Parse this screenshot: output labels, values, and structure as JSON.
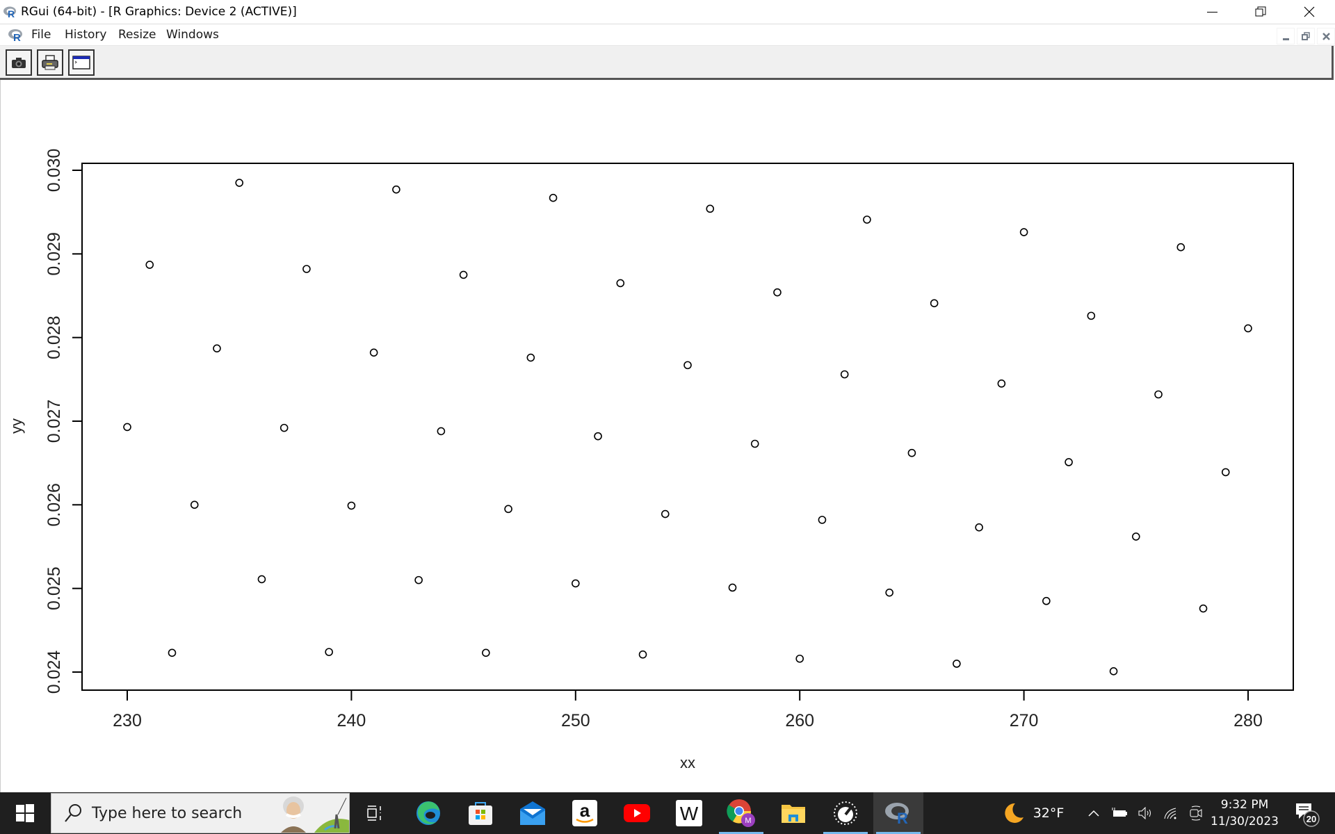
{
  "window": {
    "title": "RGui (64-bit) - [R Graphics: Device 2 (ACTIVE)]",
    "controls": {
      "minimize": "—",
      "restore": "❐",
      "close": "✕"
    }
  },
  "menubar": {
    "items": [
      {
        "label": "File"
      },
      {
        "label": "History"
      },
      {
        "label": "Resize"
      },
      {
        "label": "Windows"
      }
    ],
    "mdi_controls": {
      "minimize": "▁",
      "restore": "🗗",
      "close": "✕"
    }
  },
  "toolbar": {
    "buttons": [
      {
        "icon": "camera-icon",
        "tooltip": "Copy to clipboard"
      },
      {
        "icon": "printer-icon",
        "tooltip": "Print"
      },
      {
        "icon": "console-icon",
        "tooltip": "Return focus to console"
      }
    ]
  },
  "chart_data": {
    "type": "scatter",
    "title": "",
    "xlabel": "xx",
    "ylabel": "yy",
    "xlim": [
      228,
      282
    ],
    "ylim": [
      0.0238,
      0.0302
    ],
    "grid": false,
    "legend": "none",
    "marker": "open-circle",
    "xticks": [
      230,
      240,
      250,
      260,
      270,
      280
    ],
    "xtick_labels": [
      "230",
      "240",
      "250",
      "260",
      "270",
      "280"
    ],
    "yticks": [
      0.024,
      0.025,
      0.026,
      0.027,
      0.028,
      0.029,
      0.03
    ],
    "ytick_labels": [
      "0.024",
      "0.025",
      "0.026",
      "0.027",
      "0.028",
      "0.029",
      "0.030"
    ],
    "x": [
      230,
      231,
      232,
      233,
      234,
      235,
      236,
      237,
      238,
      239,
      240,
      241,
      242,
      243,
      244,
      245,
      246,
      247,
      248,
      249,
      250,
      251,
      252,
      253,
      254,
      255,
      256,
      257,
      258,
      259,
      260,
      261,
      262,
      263,
      264,
      265,
      266,
      267,
      268,
      269,
      270,
      271,
      272,
      273,
      274,
      275,
      276,
      277,
      278,
      279,
      280
    ],
    "y": [
      0.02693,
      0.02887,
      0.02423,
      0.026,
      0.02787,
      0.02985,
      0.02511,
      0.02692,
      0.02882,
      0.02424,
      0.02599,
      0.02782,
      0.02977,
      0.0251,
      0.02688,
      0.02875,
      0.02423,
      0.02595,
      0.02776,
      0.02967,
      0.02506,
      0.02682,
      0.02865,
      0.02421,
      0.02589,
      0.02767,
      0.02954,
      0.02501,
      0.02673,
      0.02854,
      0.02416,
      0.02582,
      0.02756,
      0.02941,
      0.02495,
      0.02662,
      0.02841,
      0.0241,
      0.02573,
      0.02745,
      0.02926,
      0.02485,
      0.02651,
      0.02826,
      0.02401,
      0.02562,
      0.02732,
      0.02908,
      0.02476,
      0.02639,
      0.02811
    ]
  },
  "taskbar": {
    "search_placeholder": "Type here to search",
    "apps": [
      {
        "name": "task-view",
        "label": "Task View"
      },
      {
        "name": "edge",
        "label": "Microsoft Edge"
      },
      {
        "name": "store",
        "label": "Microsoft Store"
      },
      {
        "name": "mail",
        "label": "Mail"
      },
      {
        "name": "amazon",
        "label": "Amazon"
      },
      {
        "name": "youtube",
        "label": "YouTube"
      },
      {
        "name": "wikipedia",
        "label": "Wikipedia",
        "glyph": "W"
      },
      {
        "name": "chrome",
        "label": "Google Chrome",
        "badge": "M"
      },
      {
        "name": "file-explorer",
        "label": "File Explorer"
      },
      {
        "name": "speedtest",
        "label": "Speedtest"
      },
      {
        "name": "rgui",
        "label": "RGui",
        "glyph": "R"
      }
    ],
    "weather": {
      "temp": "32°F"
    },
    "clock": {
      "time": "9:32 PM",
      "date": "11/30/2023"
    },
    "notifications": {
      "count": "20"
    },
    "colors": {
      "bg": "#1f1f1f",
      "running_indicator": "#76b9ed"
    }
  }
}
